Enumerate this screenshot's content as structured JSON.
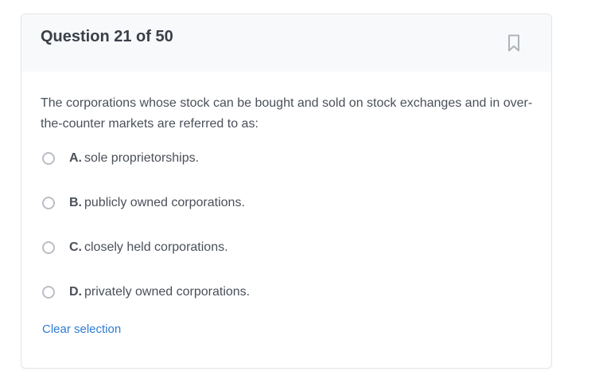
{
  "header": {
    "title": "Question 21 of 50",
    "bookmark_icon": "bookmark-icon"
  },
  "question": {
    "text": "The corporations whose stock can be bought and sold on stock exchanges and in over-the-counter markets are referred to as:"
  },
  "options": [
    {
      "letter": "A.",
      "text": "sole proprietorships.",
      "selected": false
    },
    {
      "letter": "B.",
      "text": "publicly owned corporations.",
      "selected": false
    },
    {
      "letter": "C.",
      "text": "closely held corporations.",
      "selected": false
    },
    {
      "letter": "D.",
      "text": "privately owned corporations.",
      "selected": false
    }
  ],
  "actions": {
    "clear_label": "Clear selection"
  },
  "colors": {
    "link": "#2e7bd6",
    "header_bg": "#f8f9fb",
    "text": "#4a5059"
  }
}
